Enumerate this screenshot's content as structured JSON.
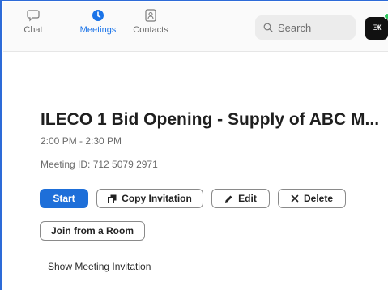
{
  "nav": {
    "items": [
      {
        "label": "Chat",
        "icon": "chat-bubble-icon"
      },
      {
        "label": "Meetings",
        "icon": "clock-icon"
      },
      {
        "label": "Contacts",
        "icon": "contact-card-icon"
      }
    ]
  },
  "search": {
    "placeholder": "Search"
  },
  "avatar": {
    "text": "ΞЖ",
    "status_color": "#2cc45c"
  },
  "meeting": {
    "title": "ILECO 1 Bid Opening - Supply of ABC M...",
    "time": "2:00 PM - 2:30 PM",
    "meeting_id": "Meeting ID: 712 5079 2971"
  },
  "actions": {
    "start": "Start",
    "copy_invitation": "Copy Invitation",
    "edit": "Edit",
    "delete": "Delete",
    "join_from_room": "Join from a Room"
  },
  "show_invitation": "Show Meeting Invitation",
  "colors": {
    "accent": "#1e6fd9",
    "active_nav": "#1a73e8"
  }
}
